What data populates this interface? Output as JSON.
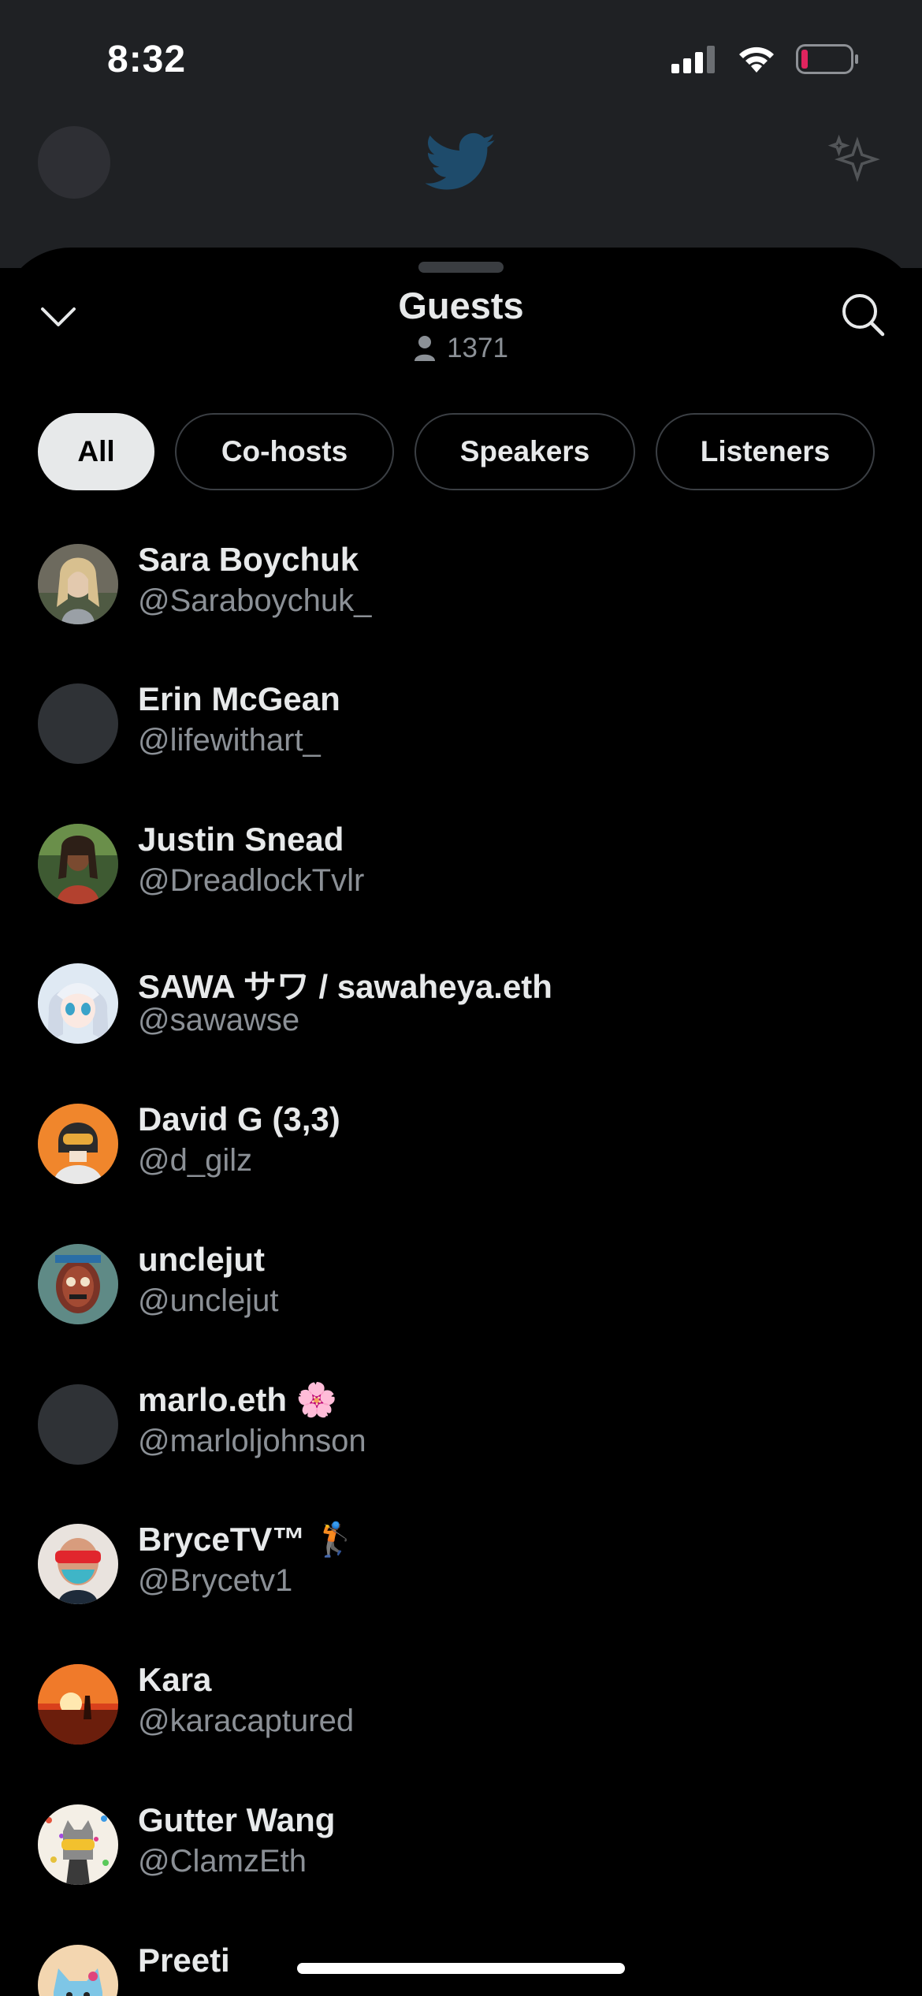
{
  "status_bar": {
    "time": "8:32",
    "battery_color": "#e0245e"
  },
  "sheet": {
    "title": "Guests",
    "guest_count": "1371",
    "filters": [
      {
        "label": "All",
        "active": true
      },
      {
        "label": "Co-hosts",
        "active": false
      },
      {
        "label": "Speakers",
        "active": false
      },
      {
        "label": "Listeners",
        "active": false
      }
    ]
  },
  "guests": [
    {
      "name": "Sara Boychuk",
      "handle": "@Saraboychuk_",
      "avatar": "photo-woman-blonde"
    },
    {
      "name": "Erin McGean",
      "handle": "@lifewithart_",
      "avatar": "placeholder"
    },
    {
      "name": "Justin Snead",
      "handle": "@DreadlockTvlr",
      "avatar": "photo-man-dreadlocks"
    },
    {
      "name": "SAWA サワ / sawaheya.eth",
      "handle": "@sawawse",
      "avatar": "anime-girl"
    },
    {
      "name": "David G (3,3)",
      "handle": "@d_gilz",
      "avatar": "helmet-orange"
    },
    {
      "name": "unclejut",
      "handle": "@unclejut",
      "avatar": "tiki-mask"
    },
    {
      "name": "marlo.eth 🌸",
      "handle": "@marloljohnson",
      "avatar": "placeholder"
    },
    {
      "name": "BryceTV™ 🏌️",
      "handle": "@Brycetv1",
      "avatar": "man-mask-glasses"
    },
    {
      "name": "Kara",
      "handle": "@karacaptured",
      "avatar": "sunset"
    },
    {
      "name": "Gutter Wang",
      "handle": "@ClamzEth",
      "avatar": "cat-dots"
    },
    {
      "name": "Preeti",
      "handle": "",
      "avatar": "blue-cat"
    }
  ],
  "colors": {
    "accent_bg": "#e7e9ea",
    "secondary_text": "#8b9096",
    "chip_border": "#3b3f44"
  }
}
